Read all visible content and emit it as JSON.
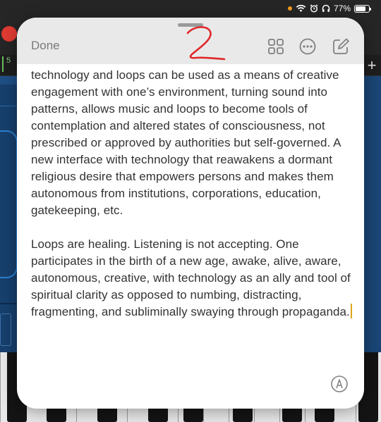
{
  "status_bar": {
    "battery_text": "77%",
    "battery_level": 0.77,
    "icons": [
      "orange-indicator-dot",
      "wifi-icon",
      "alarm-icon",
      "headphones-icon",
      "battery-icon"
    ]
  },
  "background_app": {
    "track_number": "5",
    "add_track_label": "+"
  },
  "note": {
    "done_label": "Done",
    "handwritten_annotation": "2",
    "paragraphs": [
      "technology and loops can be used as a means of creative engagement with one’s environment, turning sound into patterns, allows music and loops to become tools of contemplation and altered states of consciousness, not prescribed or approved by authorities but self-governed. A new interface with technology that reawakens a dormant religious desire that empowers persons and makes them autonomous from institutions, corporations, education, gatekeeping, etc.",
      "Loops are healing. Listening is not accepting. One participates in the birth of a new age, awake, alive, aware, autonomous, creative, with technology as an ally and tool of spiritual clarity as opposed to numbing, distracting, fragmenting, and subliminally swaying through propaganda."
    ]
  },
  "colors": {
    "annotation_red": "#e0282a",
    "caret": "#e0a419",
    "icon_gray": "#808080",
    "record_red": "#e23b32",
    "daw_blue": "#1f4f86"
  }
}
